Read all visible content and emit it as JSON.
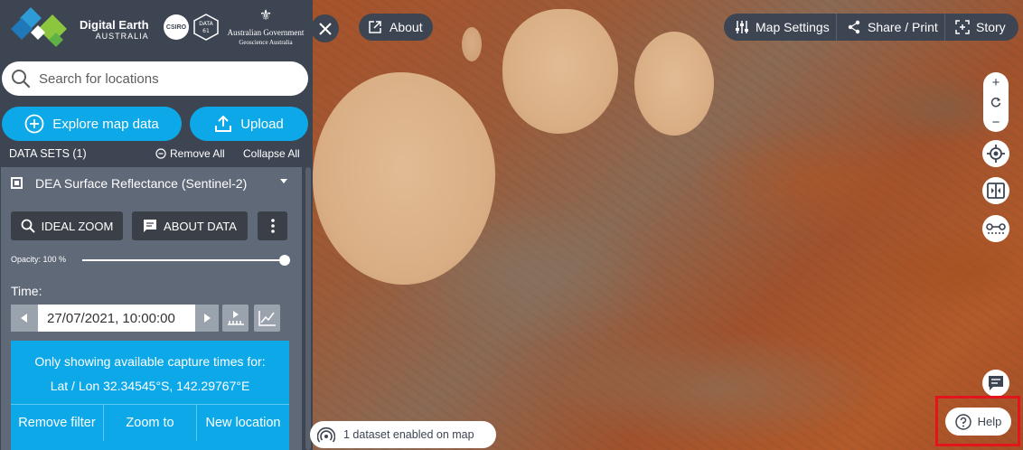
{
  "brand": {
    "name": "Digital Earth",
    "sub": "AUSTRALIA",
    "csiro": "CSIRO",
    "data61": "DATA 61",
    "gov_line1": "Australian Government",
    "gov_line2": "Geoscience Australia"
  },
  "search": {
    "placeholder": "Search for locations"
  },
  "actions": {
    "explore_label": "Explore map data",
    "upload_label": "Upload"
  },
  "datasets": {
    "header": "DATA SETS (1)",
    "remove_all": "Remove All",
    "collapse_all": "Collapse All",
    "item": {
      "title": "DEA Surface Reflectance (Sentinel-2)",
      "ideal_zoom": "IDEAL ZOOM",
      "about_data": "ABOUT DATA",
      "opacity_label": "Opacity: 100 %",
      "opacity_value": 100,
      "time_label": "Time:",
      "time_value": "27/07/2021, 10:00:00",
      "filter": {
        "line1": "Only showing available capture times for:",
        "line2": "Lat / Lon 32.34545°S, 142.29767°E",
        "remove_filter": "Remove filter",
        "zoom_to": "Zoom to",
        "new_location": "New location"
      }
    }
  },
  "map": {
    "about": "About",
    "map_settings": "Map Settings",
    "share_print": "Share / Print",
    "story": "Story",
    "zoom_in": "+",
    "zoom_out": "−",
    "help": "Help",
    "status": "1 dataset enabled on map"
  },
  "colors": {
    "panel": "#3d4552",
    "accent": "#0ca8e8",
    "card": "#606978",
    "highlight": "#e4141c"
  }
}
